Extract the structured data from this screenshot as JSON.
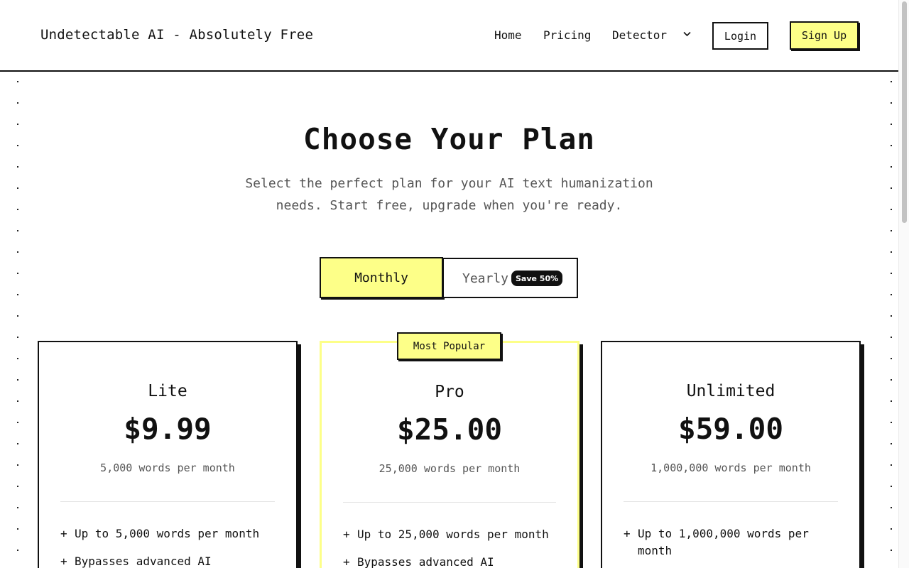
{
  "header": {
    "brand": "Undetectable AI - Absolutely Free",
    "nav": {
      "home": "Home",
      "pricing": "Pricing",
      "detector": "Detector"
    },
    "login_label": "Login",
    "signup_label": "Sign Up"
  },
  "hero": {
    "title": "Choose Your Plan",
    "subtitle": "Select the perfect plan for your AI text humanization needs. Start free, upgrade when you're ready."
  },
  "billing_toggle": {
    "monthly_label": "Monthly",
    "yearly_label": "Yearly",
    "save_badge": "Save 50%",
    "selected": "Monthly"
  },
  "plans": [
    {
      "name": "Lite",
      "price": "$9.99",
      "words": "5,000 words per month",
      "features": [
        "Up to 5,000 words per month",
        "Bypasses advanced AI"
      ]
    },
    {
      "name": "Pro",
      "badge": "Most Popular",
      "price": "$25.00",
      "words": "25,000 words per month",
      "features": [
        "Up to 25,000 words per month",
        "Bypasses advanced AI"
      ]
    },
    {
      "name": "Unlimited",
      "price": "$59.00",
      "words": "1,000,000 words per month",
      "features": [
        "Up to 1,000,000 words per month"
      ]
    }
  ],
  "colors": {
    "accent": "#fdff88",
    "border": "#111111",
    "muted_text": "#555555"
  },
  "icons": {
    "detector_dropdown": "chevron-down-icon"
  }
}
